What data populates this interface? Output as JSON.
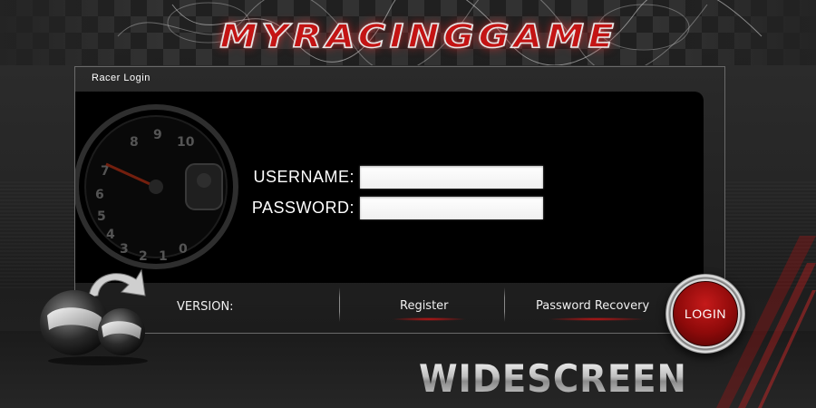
{
  "header": {
    "logo_text": "MYRACINGGAME"
  },
  "panel": {
    "title": "Racer Login"
  },
  "form": {
    "username_label": "USERNAME:",
    "username_value": "",
    "password_label": "PASSWORD:",
    "password_value": ""
  },
  "footer": {
    "version_label": "VERSION:",
    "register_label": "Register",
    "recovery_label": "Password Recovery",
    "login_label": "LOGIN"
  },
  "badge": {
    "text": "WIDESCREEN"
  },
  "gauge": {
    "ticks": [
      "8",
      "9",
      "10",
      "7",
      "6",
      "5",
      "4",
      "3",
      "2",
      "1",
      "0"
    ]
  },
  "colors": {
    "accent_red": "#c41414",
    "panel_black": "#000000",
    "text_white": "#ffffff"
  },
  "icons": {
    "helmet": "helmet-icon",
    "gauge": "tachometer-icon",
    "refresh": "refresh-arrow-icon"
  }
}
